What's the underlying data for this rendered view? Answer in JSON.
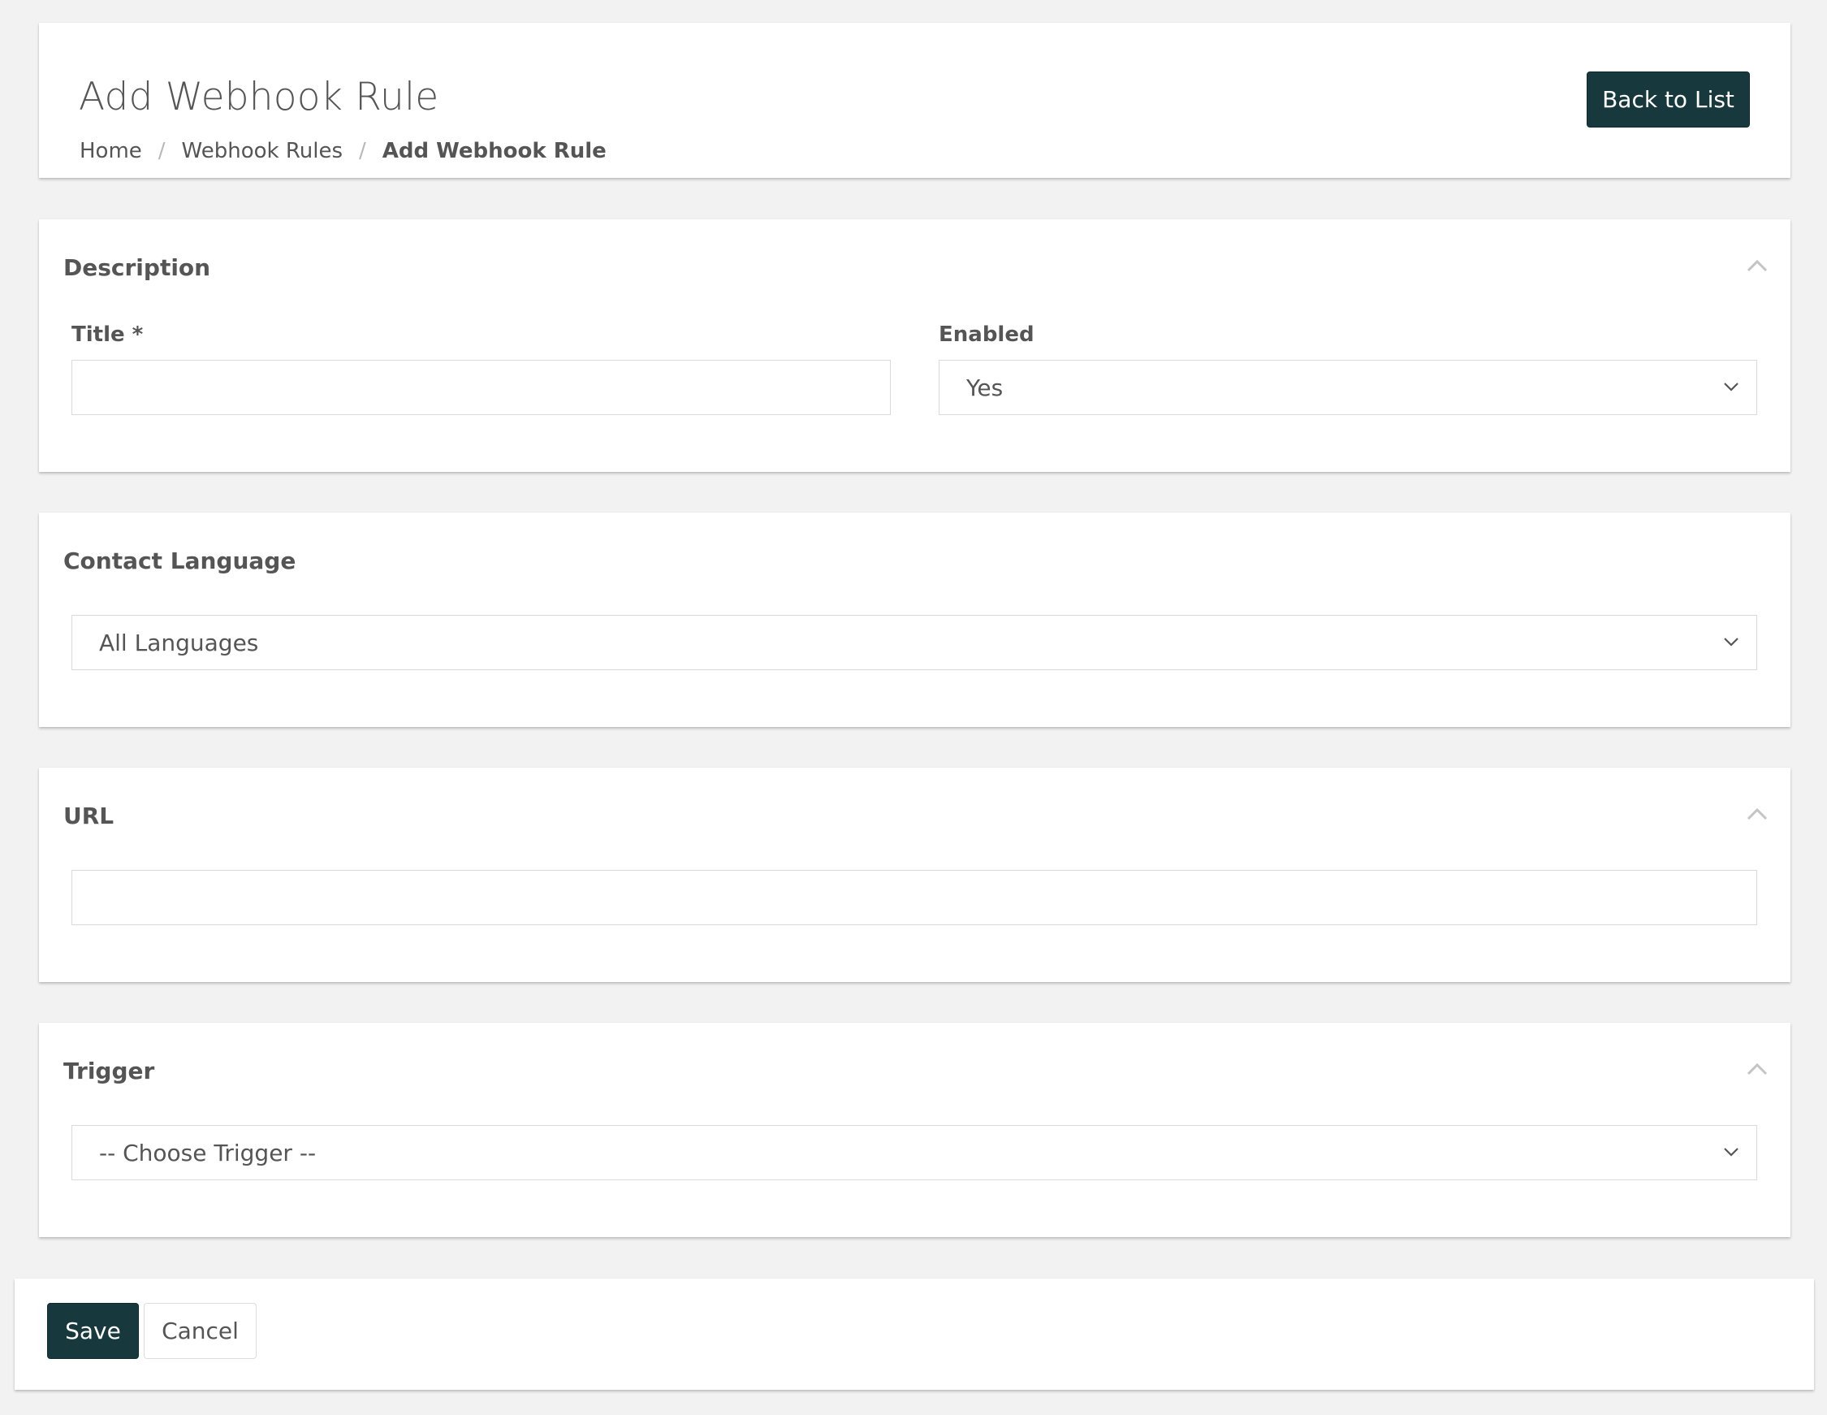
{
  "header": {
    "title": "Add Webhook Rule",
    "breadcrumb": [
      "Home",
      "Webhook Rules",
      "Add Webhook Rule"
    ],
    "breadcrumb_separator": "/",
    "back_button_label": "Back to List"
  },
  "sections": {
    "description": {
      "title": "Description",
      "title_label": "Title *",
      "title_value": "",
      "enabled_label": "Enabled",
      "enabled_selected": "Yes"
    },
    "contact_language": {
      "title": "Contact Language",
      "selected": "All Languages"
    },
    "url": {
      "title": "URL",
      "value": ""
    },
    "trigger": {
      "title": "Trigger",
      "selected": "-- Choose Trigger --"
    }
  },
  "footer": {
    "save_label": "Save",
    "cancel_label": "Cancel"
  },
  "icons": {
    "collapse": "chevron-up-icon",
    "dropdown": "chevron-down-icon"
  },
  "colors": {
    "primary_button": "#17393d",
    "page_background": "#f2f2f2",
    "text": "#555555"
  }
}
